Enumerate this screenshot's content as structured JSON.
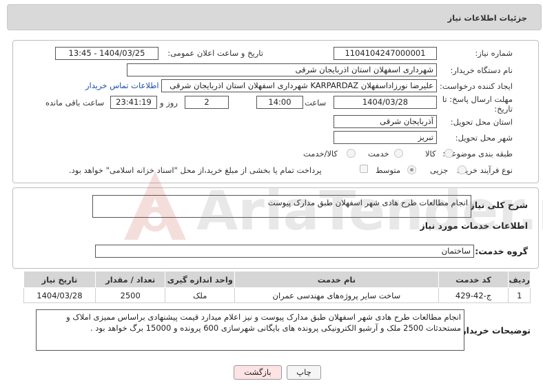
{
  "header": {
    "title": "جزئیات اطلاعات نیاز"
  },
  "fields": {
    "need_number_label": "شماره نیاز:",
    "need_number": "1104104247000001",
    "announce_label": "تاریخ و ساعت اعلان عمومی:",
    "announce_value": "1404/03/25 - 13:45",
    "buyer_org_label": "نام دستگاه خریدار:",
    "buyer_org": "شهرداری اسفهلان استان اذربایجان شرقی",
    "creator_label": "ایجاد کننده درخواست:",
    "creator": "علیرضا نورزاداسفهلان KARPARDAZ شهرداری اسفهلان استان اذربایجان شرقی",
    "contact_link": "اطلاعات تماس خریدار",
    "deadline_label_1": "مهلت ارسال پاسخ: تا",
    "deadline_label_2": "تاریخ:",
    "deadline_date": "1404/03/28",
    "time_label": "ساعت",
    "deadline_time": "14:00",
    "days_value": "2",
    "days_label": "روز و",
    "remaining_time": "23:41:19",
    "remaining_label": "ساعت باقی مانده",
    "province_label": "استان محل تحویل:",
    "province": "آذربایجان شرقی",
    "city_label": "شهر محل تحویل:",
    "city": "تبریز",
    "category_label": "طبقه بندی موضوعی:",
    "category_options": [
      "کالا",
      "خدمت",
      "کالا/خدمت"
    ],
    "process_label": "نوع فرآیند خرید :",
    "process_options": [
      "جزیی",
      "متوسط"
    ],
    "payment_note": "پرداخت تمام یا بخشی از مبلغ خرید،از محل \"اسناد خزانه اسلامی\" خواهد بود."
  },
  "description": {
    "label": "شرح کلی نیاز:",
    "value": "انجام مطالعات طرح هادی شهر اسفهلان طبق مدارک پیوست"
  },
  "services": {
    "title": "اطلاعات خدمات مورد نیاز",
    "group_label": "گروه خدمت:",
    "group_value": "ساختمان",
    "columns": [
      "ردیف",
      "کد خدمت",
      "نام خدمت",
      "واحد اندازه گیری",
      "تعداد / مقدار",
      "تاریخ نیاز"
    ],
    "rows": [
      [
        "1",
        "ج-42-429",
        "ساخت سایر پروژه‌های مهندسی عمران",
        "ملک",
        "2500",
        "1404/03/28"
      ]
    ]
  },
  "buyer_notes": {
    "label": "توضیحات خریدار:",
    "value": "انجام مطالعات طرح هادی شهر اسفهلان طبق مدارک پیوست  و نیز اعلام میدارد قیمت پیشنهادی براساس ممیزی املاک و مستحدثات 2500 ملک و آرشیو الکترونیکی پرونده های بایگانی شهرسازی 600 پرونده و 15000 برگ خواهد بود ."
  },
  "buttons": {
    "print": "چاپ",
    "back": "بازگشت"
  },
  "watermark": {
    "text": "AriaTender.net"
  },
  "colors": {
    "link": "#1a50b0",
    "back_button_bg": "#fde3e3",
    "watermark": "#c0392b"
  }
}
